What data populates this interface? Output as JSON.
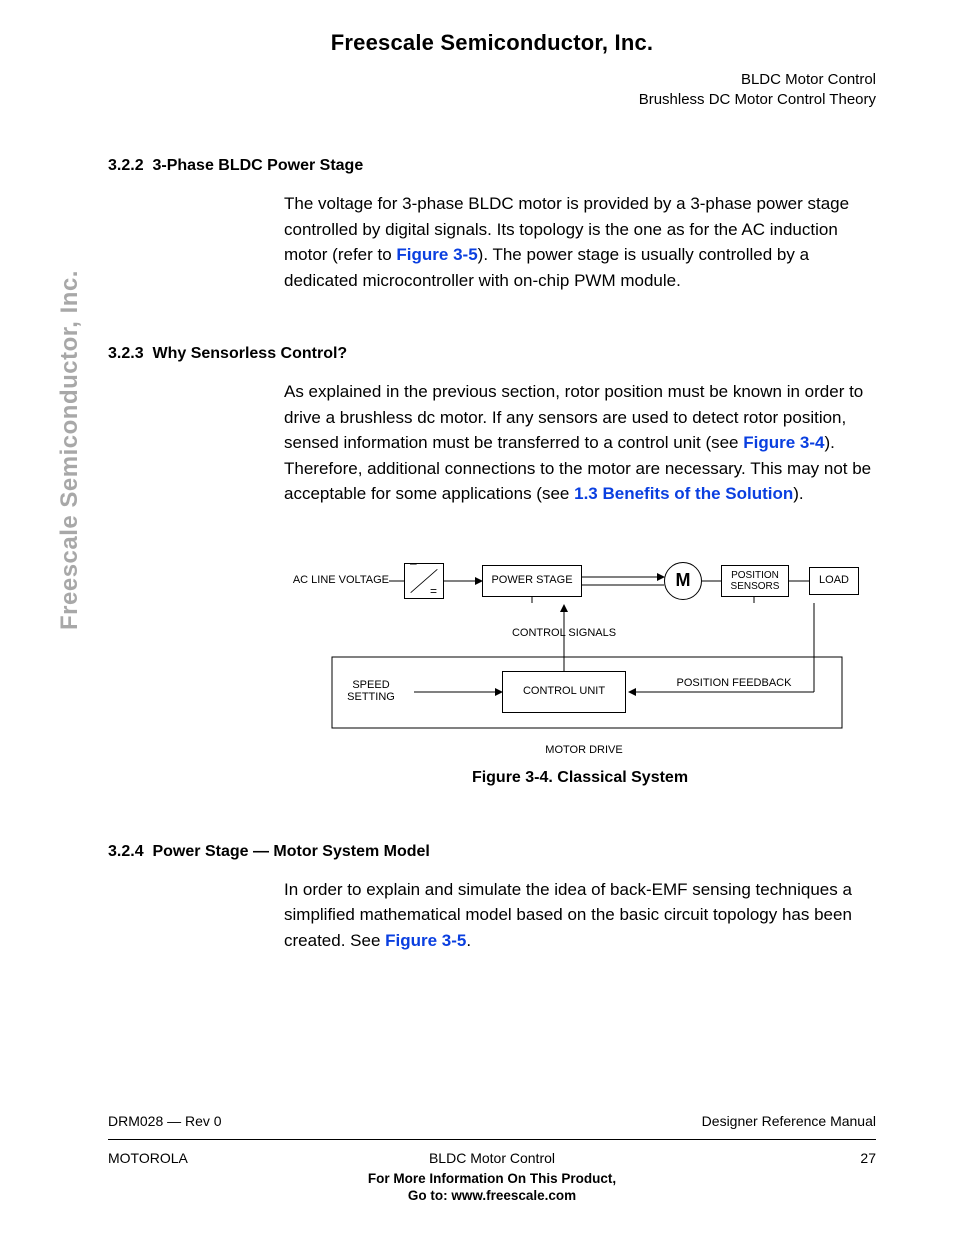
{
  "header": {
    "company": "Freescale Semiconductor, Inc.",
    "line1": "BLDC Motor Control",
    "line2": "Brushless DC Motor Control Theory"
  },
  "sidebar_brand": "Freescale Semiconductor, Inc.",
  "sections": {
    "s322": {
      "num": "3.2.2",
      "title": "3-Phase BLDC Power Stage",
      "p1a": "The voltage for 3-phase BLDC motor is provided by a 3-phase power stage controlled by digital signals. Its topology is the one as for the AC induction motor (refer to ",
      "link1": "Figure 3-5",
      "p1b": "). The power stage is usually controlled by a dedicated microcontroller with on-chip PWM module."
    },
    "s323": {
      "num": "3.2.3",
      "title": "Why Sensorless Control?",
      "p1a": "As explained in the previous section, rotor position must be known in order to drive a brushless dc motor. If any sensors are used to detect rotor position, sensed information must be transferred to a control unit (see ",
      "link1": "Figure 3-4",
      "p1b": "). Therefore, additional connections to the motor are necessary. This may not be acceptable for some applications (see ",
      "link2": "1.3 Benefits of the Solution",
      "p1c": ")."
    },
    "s324": {
      "num": "3.2.4",
      "title": "Power Stage — Motor System Model",
      "p1a": "In order to explain and simulate the idea of back-EMF sensing techniques a simplified mathematical model based on the basic circuit topology has been created. See ",
      "link1": "Figure 3-5",
      "p1b": "."
    }
  },
  "figure": {
    "caption": "Figure 3-4. Classical System",
    "labels": {
      "ac_line": "AC LINE VOLTAGE",
      "power_stage": "POWER STAGE",
      "position_sensors": "POSITION SENSORS",
      "load": "LOAD",
      "motor": "M",
      "control_signals": "CONTROL SIGNALS",
      "speed_setting": "SPEED SETTING",
      "control_unit": "CONTROL UNIT",
      "position_feedback": "POSITION FEEDBACK",
      "motor_drive": "MOTOR DRIVE",
      "minus": "–",
      "eq": "="
    }
  },
  "footer": {
    "rev": "DRM028 — Rev 0",
    "docname": "Designer Reference Manual",
    "left": "MOTOROLA",
    "center": "BLDC Motor Control",
    "page": "27",
    "info1": "For More Information On This Product,",
    "info2": "Go to: www.freescale.com"
  }
}
